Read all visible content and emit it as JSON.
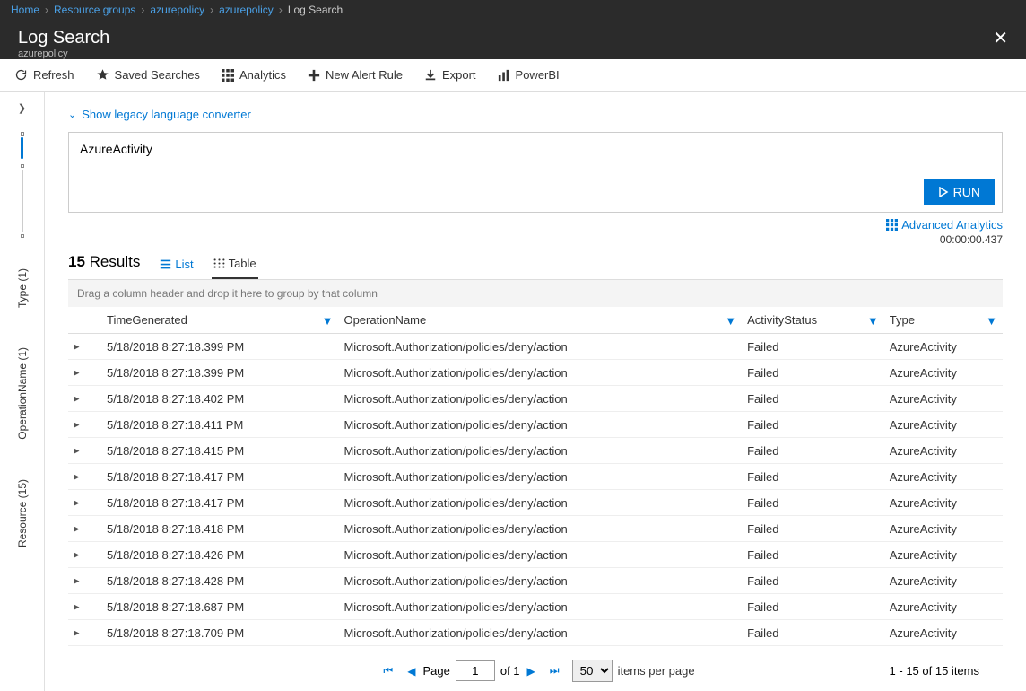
{
  "breadcrumb": {
    "items": [
      "Home",
      "Resource groups",
      "azurepolicy",
      "azurepolicy"
    ],
    "current": "Log Search"
  },
  "header": {
    "title": "Log Search",
    "subtitle": "azurepolicy"
  },
  "toolbar": {
    "refresh": "Refresh",
    "saved": "Saved Searches",
    "analytics": "Analytics",
    "new_alert": "New Alert Rule",
    "export": "Export",
    "powerbi": "PowerBI"
  },
  "rail": {
    "type": "Type (1)",
    "operation": "OperationName (1)",
    "resource": "Resource (15)"
  },
  "legacy_link": "Show legacy language converter",
  "query": "AzureActivity",
  "run_label": "RUN",
  "advanced_analytics": "Advanced Analytics",
  "timing": "00:00:00.437",
  "results_count": "15",
  "results_label": "Results",
  "view_list": "List",
  "view_table": "Table",
  "group_hint": "Drag a column header and drop it here to group by that column",
  "columns": {
    "time": "TimeGenerated",
    "op": "OperationName",
    "status": "ActivityStatus",
    "type": "Type"
  },
  "rows": [
    {
      "t": "5/18/2018 8:27:18.399 PM",
      "o": "Microsoft.Authorization/policies/deny/action",
      "s": "Failed",
      "ty": "AzureActivity"
    },
    {
      "t": "5/18/2018 8:27:18.399 PM",
      "o": "Microsoft.Authorization/policies/deny/action",
      "s": "Failed",
      "ty": "AzureActivity"
    },
    {
      "t": "5/18/2018 8:27:18.402 PM",
      "o": "Microsoft.Authorization/policies/deny/action",
      "s": "Failed",
      "ty": "AzureActivity"
    },
    {
      "t": "5/18/2018 8:27:18.411 PM",
      "o": "Microsoft.Authorization/policies/deny/action",
      "s": "Failed",
      "ty": "AzureActivity"
    },
    {
      "t": "5/18/2018 8:27:18.415 PM",
      "o": "Microsoft.Authorization/policies/deny/action",
      "s": "Failed",
      "ty": "AzureActivity"
    },
    {
      "t": "5/18/2018 8:27:18.417 PM",
      "o": "Microsoft.Authorization/policies/deny/action",
      "s": "Failed",
      "ty": "AzureActivity"
    },
    {
      "t": "5/18/2018 8:27:18.417 PM",
      "o": "Microsoft.Authorization/policies/deny/action",
      "s": "Failed",
      "ty": "AzureActivity"
    },
    {
      "t": "5/18/2018 8:27:18.418 PM",
      "o": "Microsoft.Authorization/policies/deny/action",
      "s": "Failed",
      "ty": "AzureActivity"
    },
    {
      "t": "5/18/2018 8:27:18.426 PM",
      "o": "Microsoft.Authorization/policies/deny/action",
      "s": "Failed",
      "ty": "AzureActivity"
    },
    {
      "t": "5/18/2018 8:27:18.428 PM",
      "o": "Microsoft.Authorization/policies/deny/action",
      "s": "Failed",
      "ty": "AzureActivity"
    },
    {
      "t": "5/18/2018 8:27:18.687 PM",
      "o": "Microsoft.Authorization/policies/deny/action",
      "s": "Failed",
      "ty": "AzureActivity"
    },
    {
      "t": "5/18/2018 8:27:18.709 PM",
      "o": "Microsoft.Authorization/policies/deny/action",
      "s": "Failed",
      "ty": "AzureActivity"
    }
  ],
  "pager": {
    "page_label": "Page",
    "page": "1",
    "of_label": "of 1",
    "per_page": "50",
    "per_page_label": "items per page",
    "summary": "1 - 15 of 15 items"
  }
}
